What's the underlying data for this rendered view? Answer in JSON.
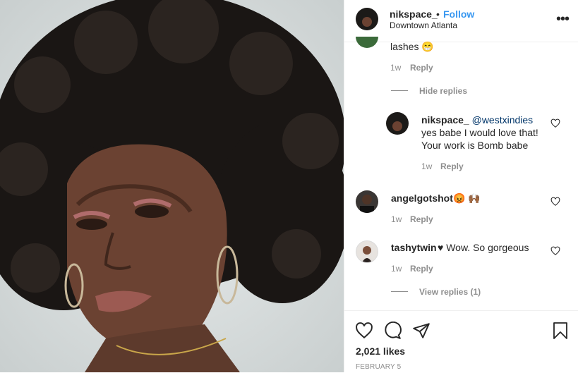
{
  "post": {
    "username": "nikspace_",
    "separator": "•",
    "follow_label": "Follow",
    "location": "Downtown Atlanta",
    "more_icon": "more-options-icon"
  },
  "comments": {
    "partial_text": "lashes 😁",
    "partial_time": "1w",
    "partial_reply": "Reply",
    "hide_replies": "Hide replies",
    "reply": {
      "username": "nikspace_",
      "mention": "@westxindies",
      "text": "yes babe I would love that! Your work is Bomb babe",
      "time": "1w",
      "reply_label": "Reply"
    },
    "items": [
      {
        "username": "angelgotshot",
        "text": "😡 🙌🏾",
        "time": "1w",
        "reply_label": "Reply"
      },
      {
        "username": "tashytwin",
        "text": "♥ Wow. So gorgeous",
        "time": "1w",
        "reply_label": "Reply"
      }
    ],
    "view_replies": "View replies (1)"
  },
  "footer": {
    "likes": "2,021 likes",
    "date": "FEBRUARY 5"
  },
  "colors": {
    "link": "#003569",
    "follow": "#3897f0",
    "muted": "#8e8e8e"
  }
}
